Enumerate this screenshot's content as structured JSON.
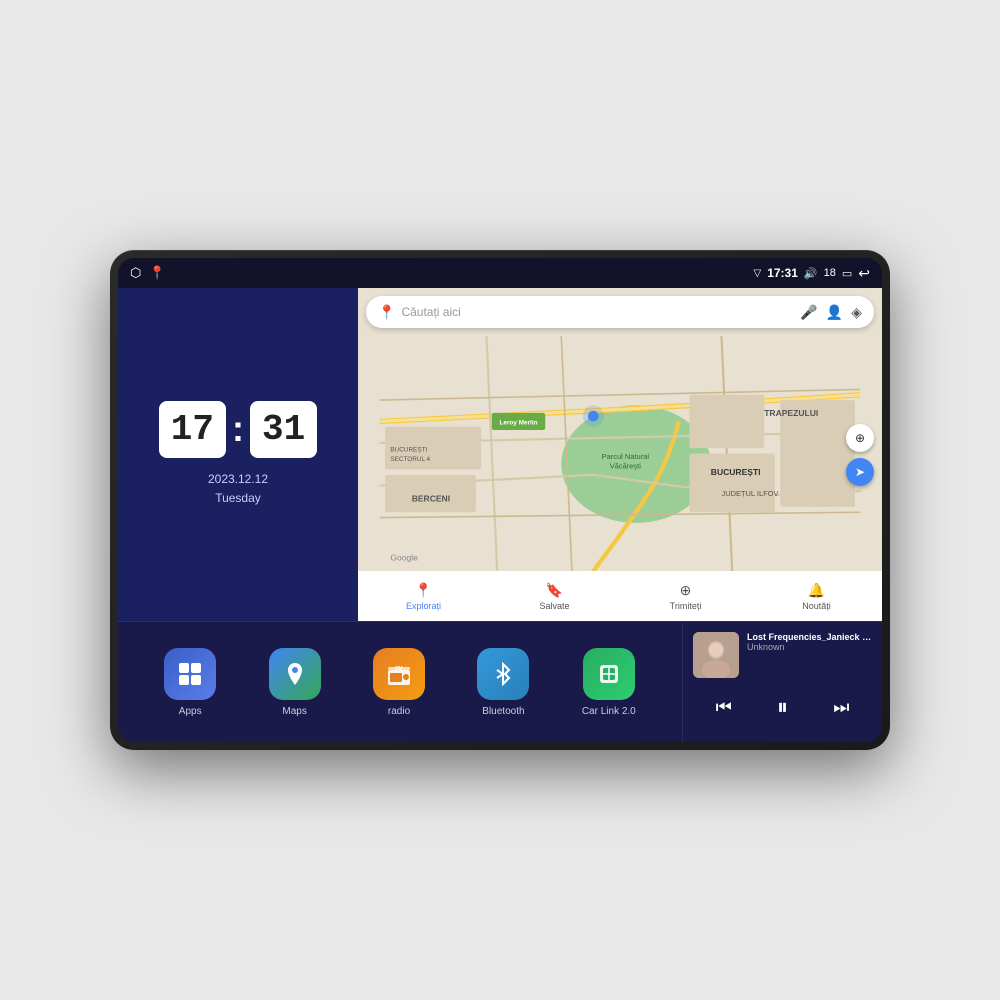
{
  "device": {
    "status_bar": {
      "left_icons": [
        "⬡",
        "📍"
      ],
      "time": "17:31",
      "signal": "▼",
      "volume_icon": "🔊",
      "battery": "18",
      "battery_icon": "▭",
      "back_icon": "↩"
    },
    "clock": {
      "hours": "17",
      "minutes": "31",
      "date": "2023.12.12",
      "day": "Tuesday"
    },
    "map": {
      "search_placeholder": "Căutați aici",
      "bottom_items": [
        {
          "label": "Explorați",
          "icon": "📍",
          "active": true
        },
        {
          "label": "Salvate",
          "icon": "🔖",
          "active": false
        },
        {
          "label": "Trimiteți",
          "icon": "⊕",
          "active": false
        },
        {
          "label": "Noutăți",
          "icon": "🔔",
          "active": false
        }
      ],
      "location_names": [
        "TRAPEZULUI",
        "BUCUREȘTI",
        "JUDEȚUL ILFOV",
        "BERCENI",
        "Parcul Natural Văcărești",
        "Leroy Merlin",
        "BUCUREȘTI SECTORUL 4"
      ]
    },
    "apps": [
      {
        "id": "apps",
        "label": "Apps",
        "icon": "⊞",
        "bg": "apps-bg"
      },
      {
        "id": "maps",
        "label": "Maps",
        "icon": "📍",
        "bg": "maps-bg"
      },
      {
        "id": "radio",
        "label": "radio",
        "icon": "📻",
        "bg": "radio-bg"
      },
      {
        "id": "bluetooth",
        "label": "Bluetooth",
        "icon": "⬡",
        "bg": "bt-bg"
      },
      {
        "id": "carlink",
        "label": "Car Link 2.0",
        "icon": "📱",
        "bg": "carlink-bg"
      }
    ],
    "music": {
      "title": "Lost Frequencies_Janieck Devy-...",
      "artist": "Unknown",
      "controls": {
        "prev": "⏮",
        "play": "⏸",
        "next": "⏭"
      }
    }
  }
}
